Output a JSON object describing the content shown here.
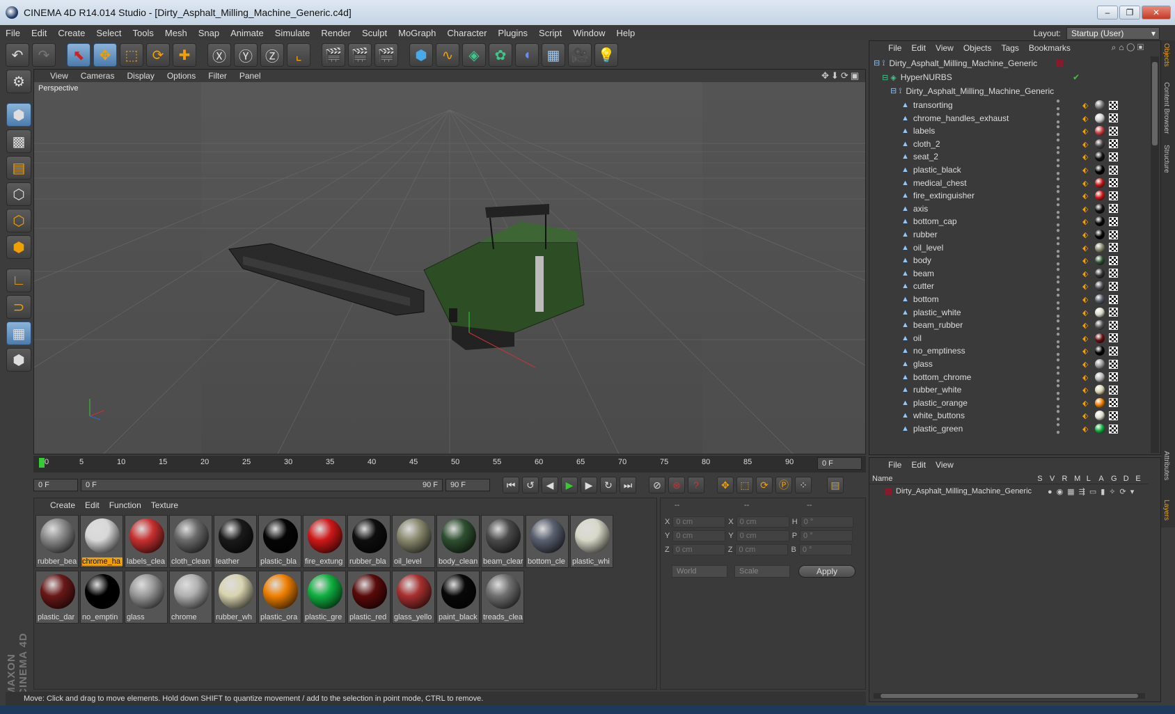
{
  "window": {
    "title": "CINEMA 4D R14.014 Studio - [Dirty_Asphalt_Milling_Machine_Generic.c4d]",
    "buttons": [
      "–",
      "❐",
      "✕"
    ]
  },
  "menu": [
    "File",
    "Edit",
    "Create",
    "Select",
    "Tools",
    "Mesh",
    "Snap",
    "Animate",
    "Simulate",
    "Render",
    "Sculpt",
    "MoGraph",
    "Character",
    "Plugins",
    "Script",
    "Window",
    "Help"
  ],
  "layout": {
    "label": "Layout:",
    "value": "Startup (User)"
  },
  "toolbar_icons": [
    "undo-icon",
    "redo-icon",
    "live-select-icon",
    "move-icon",
    "scale-icon",
    "rotate-icon",
    "add-icon",
    "x-axis-icon",
    "y-axis-icon",
    "z-axis-icon",
    "coord-system-icon",
    "render-view-icon",
    "render-picture-viewer-icon",
    "render-settings-icon",
    "cube-icon",
    "spline-icon",
    "nurbs-icon",
    "array-icon",
    "deformer-icon",
    "floor-icon",
    "camera-icon",
    "light-icon"
  ],
  "viewport": {
    "menu": [
      "View",
      "Cameras",
      "Display",
      "Options",
      "Filter",
      "Panel"
    ],
    "label": "Perspective"
  },
  "timeline": {
    "ticks": [
      "0",
      "5",
      "10",
      "15",
      "20",
      "25",
      "30",
      "35",
      "40",
      "45",
      "50",
      "55",
      "60",
      "65",
      "70",
      "75",
      "80",
      "85",
      "90"
    ],
    "current": "0 F"
  },
  "transport": {
    "start": "0 F",
    "range_start": "0 F",
    "range_end": "90 F",
    "end": "90 F"
  },
  "materials": {
    "menu": [
      "Create",
      "Edit",
      "Function",
      "Texture"
    ],
    "items": [
      {
        "label": "rubber_bea",
        "color": "#8a8a8a",
        "selected": false
      },
      {
        "label": "chrome_ha",
        "color": "#d8d8d8",
        "selected": true
      },
      {
        "label": "labels_clea",
        "color": "#c83030",
        "selected": false
      },
      {
        "label": "cloth_clean",
        "color": "#6a6a6a",
        "selected": false
      },
      {
        "label": "leather",
        "color": "#1a1a1a",
        "selected": false
      },
      {
        "label": "plastic_bla",
        "color": "#050505",
        "selected": false
      },
      {
        "label": "fire_extung",
        "color": "#d01818",
        "selected": false
      },
      {
        "label": "rubber_bla",
        "color": "#0e0e0e",
        "selected": false
      },
      {
        "label": "oil_level",
        "color": "#8a8a70",
        "selected": false
      },
      {
        "label": "body_clean",
        "color": "#2f5030",
        "selected": false
      },
      {
        "label": "beam_clear",
        "color": "#4a4a4a",
        "selected": false
      },
      {
        "label": "bottom_cle",
        "color": "#5a6070",
        "selected": false
      },
      {
        "label": "plastic_whi",
        "color": "#d8d8c8",
        "selected": false
      },
      {
        "label": "plastic_dar",
        "color": "#6a1818",
        "selected": false
      },
      {
        "label": "no_emptin",
        "color": "#000000",
        "selected": false
      },
      {
        "label": "glass",
        "color": "#9a9a9a",
        "selected": false
      },
      {
        "label": "chrome",
        "color": "#b0b0b0",
        "selected": false
      },
      {
        "label": "rubber_wh",
        "color": "#d8d4b0",
        "selected": false
      },
      {
        "label": "plastic_ora",
        "color": "#f08000",
        "selected": false
      },
      {
        "label": "plastic_gre",
        "color": "#10b040",
        "selected": false
      },
      {
        "label": "plastic_red",
        "color": "#5a0a0a",
        "selected": false
      },
      {
        "label": "glass_yello",
        "color": "#a83030",
        "selected": false
      },
      {
        "label": "paint_black",
        "color": "#080808",
        "selected": false
      },
      {
        "label": "treads_clea",
        "color": "#707070",
        "selected": false
      }
    ]
  },
  "attributes": {
    "header": [
      "--",
      "--",
      "--"
    ],
    "rows": [
      {
        "a": "X",
        "av": "0 cm",
        "b": "X",
        "bv": "0 cm",
        "c": "H",
        "cv": "0 °"
      },
      {
        "a": "Y",
        "av": "0 cm",
        "b": "Y",
        "bv": "0 cm",
        "c": "P",
        "cv": "0 °"
      },
      {
        "a": "Z",
        "av": "0 cm",
        "b": "Z",
        "bv": "0 cm",
        "c": "B",
        "cv": "0 °"
      }
    ],
    "coord_mode": "World",
    "size_mode": "Scale",
    "apply": "Apply"
  },
  "objects": {
    "menu": [
      "File",
      "Edit",
      "View",
      "Objects",
      "Tags",
      "Bookmarks"
    ],
    "root": "Dirty_Asphalt_Milling_Machine_Generic",
    "hypernurbs": "HyperNURBS",
    "group": "Dirty_Asphalt_Milling_Machine_Generic",
    "items": [
      {
        "name": "transorting",
        "color": "#7a7a7a"
      },
      {
        "name": "chrome_handles_exhaust",
        "color": "#d0d0d0"
      },
      {
        "name": "labels",
        "color": "#c84040"
      },
      {
        "name": "cloth_2",
        "color": "#444444"
      },
      {
        "name": "seat_2",
        "color": "#111111"
      },
      {
        "name": "plastic_black",
        "color": "#000000"
      },
      {
        "name": "medical_chest",
        "color": "#c01818"
      },
      {
        "name": "fire_extinguisher",
        "color": "#d01818"
      },
      {
        "name": "axis",
        "color": "#111111"
      },
      {
        "name": "bottom_cap",
        "color": "#080808"
      },
      {
        "name": "rubber",
        "color": "#050505"
      },
      {
        "name": "oil_level",
        "color": "#8a8a70"
      },
      {
        "name": "body",
        "color": "#2f5030"
      },
      {
        "name": "beam",
        "color": "#333333"
      },
      {
        "name": "cutter",
        "color": "#4a4a50"
      },
      {
        "name": "bottom",
        "color": "#555a66"
      },
      {
        "name": "plastic_white",
        "color": "#d8d8c8"
      },
      {
        "name": "beam_rubber",
        "color": "#555555"
      },
      {
        "name": "oil",
        "color": "#6a1010"
      },
      {
        "name": "no_emptiness",
        "color": "#000000"
      },
      {
        "name": "glass",
        "color": "#9a9a9a"
      },
      {
        "name": "bottom_chrome",
        "color": "#b8b8b8"
      },
      {
        "name": "rubber_white",
        "color": "#d8d4b0"
      },
      {
        "name": "plastic_orange",
        "color": "#f08000"
      },
      {
        "name": "white_buttons",
        "color": "#e0e0d0"
      },
      {
        "name": "plastic_green",
        "color": "#10b040"
      }
    ]
  },
  "layers": {
    "menu": [
      "File",
      "Edit",
      "View"
    ],
    "columns": [
      "Name",
      "S",
      "V",
      "R",
      "M",
      "L",
      "A",
      "G",
      "D",
      "E"
    ],
    "row": "Dirty_Asphalt_Milling_Machine_Generic"
  },
  "side_tabs": [
    "Objects",
    "Content Browser",
    "Structure",
    "Attributes",
    "Layers"
  ],
  "brand": "MAXON CINEMA 4D",
  "status": "Move: Click and drag to move elements. Hold down SHIFT to quantize movement / add to the selection in point mode, CTRL to remove."
}
